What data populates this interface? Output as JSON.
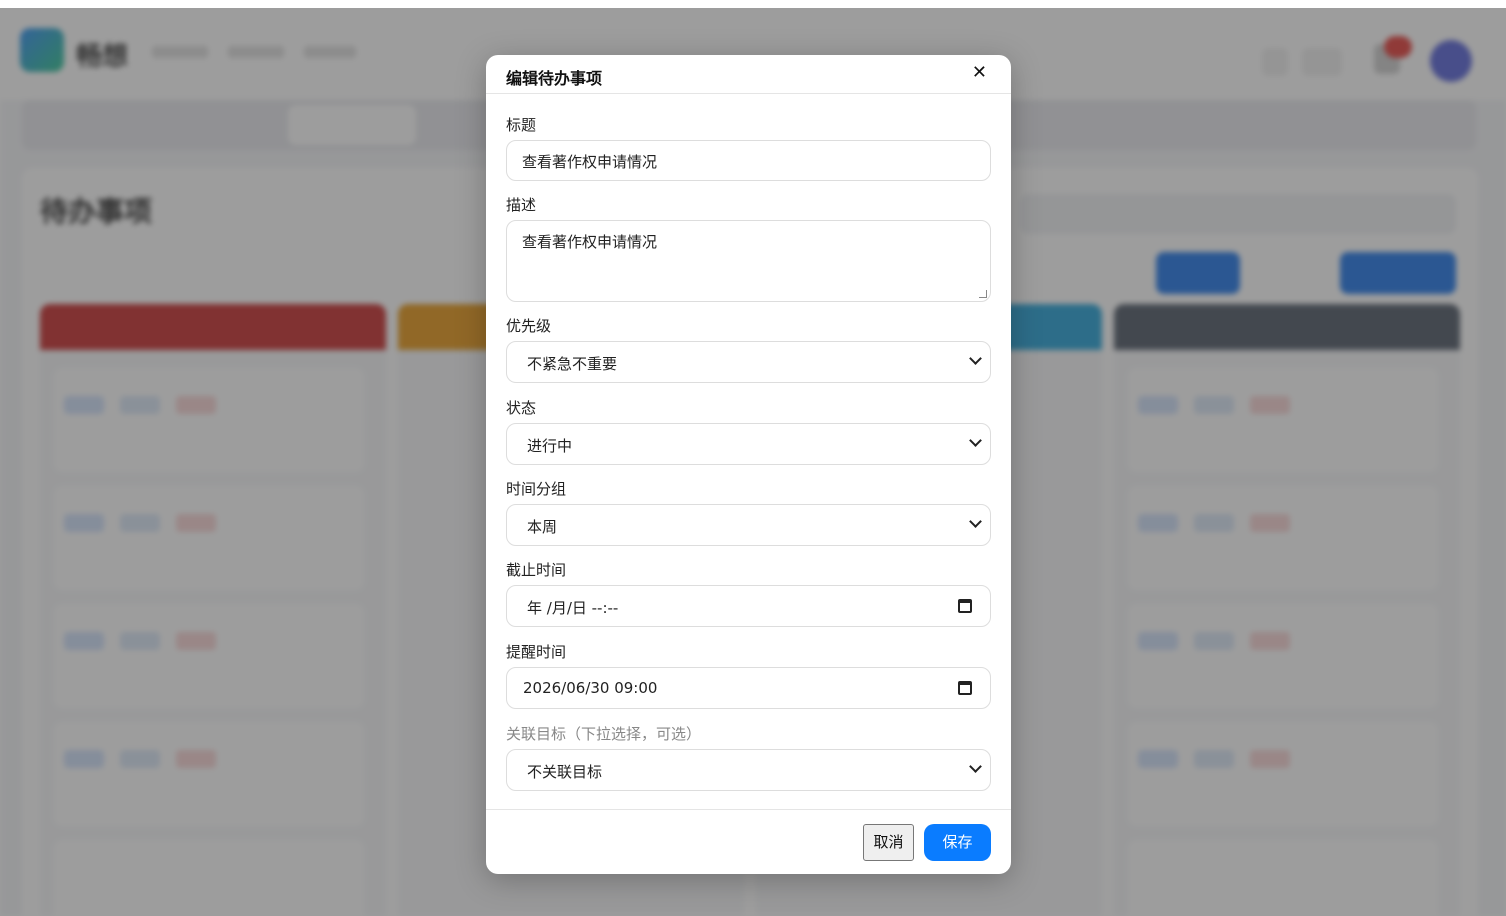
{
  "background": {
    "brand": "畅想",
    "page_title": "待办事项"
  },
  "modal": {
    "title": "编辑待办事项",
    "close_label": "✕",
    "fields": {
      "title_label": "标题",
      "title_value": "查看著作权申请情况",
      "desc_label": "描述",
      "desc_value": "查看著作权申请情况",
      "priority_label": "优先级",
      "priority_value": "不紧急不重要",
      "status_label": "状态",
      "status_value": "进行中",
      "time_group_label": "时间分组",
      "time_group_value": "本周",
      "deadline_label": "截止时间",
      "deadline_value": "年 /月/日  --:--",
      "reminder_label": "提醒时间",
      "reminder_value": "2026/06/30  09:00",
      "goal_label": "关联目标（下拉选择，可选）",
      "goal_value": "不关联目标"
    },
    "cancel_label": "取消",
    "save_label": "保存"
  },
  "colors": {
    "primary": "#0a7cff",
    "overlay": "rgba(60,60,60,0.5)",
    "column_urgent": "#c62828",
    "column_orange": "#e69512",
    "column_cyan": "#1e9fd6",
    "column_gray": "#4b5563"
  }
}
